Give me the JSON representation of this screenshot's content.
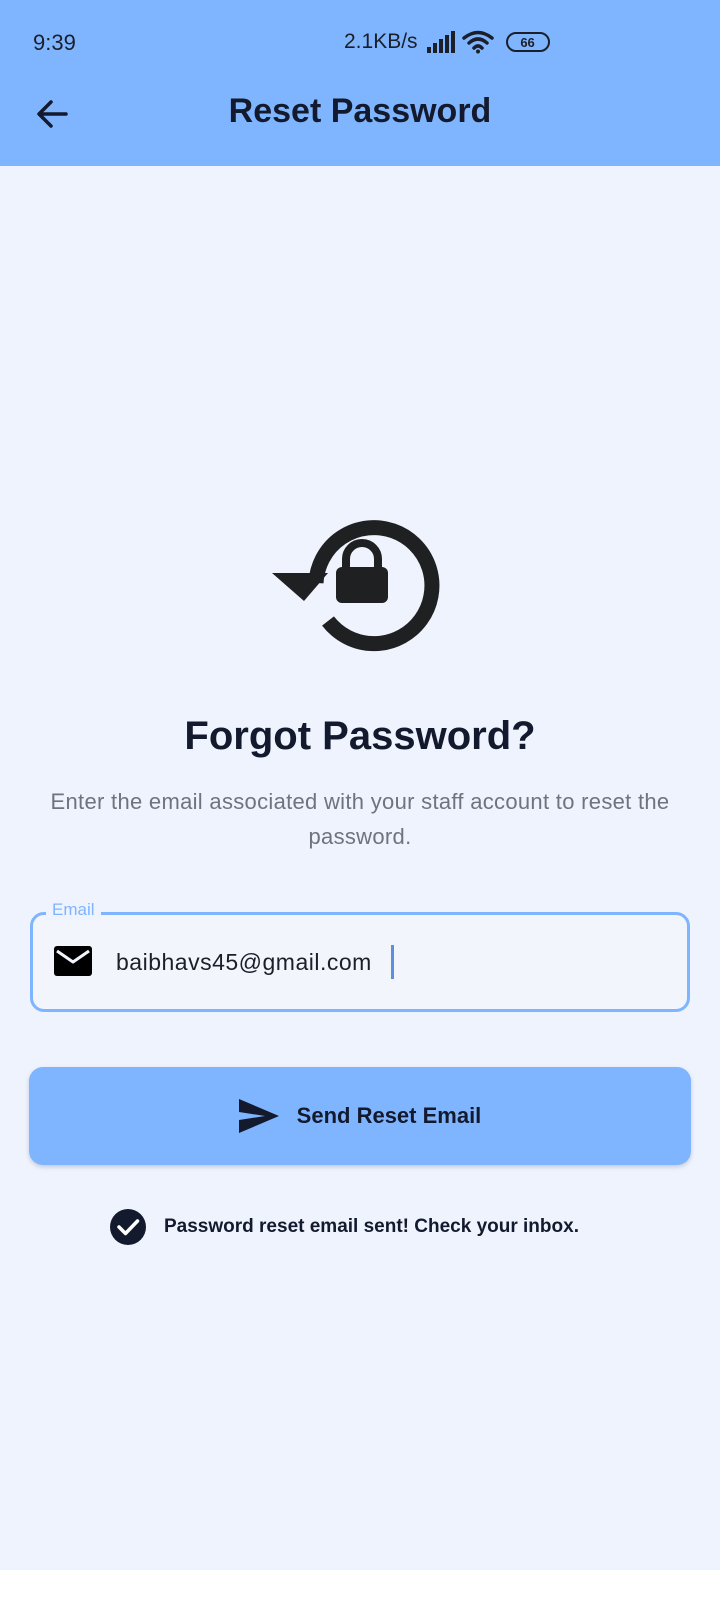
{
  "status_bar": {
    "time": "9:39",
    "network_speed": "2.1KB/s",
    "battery_level": "66",
    "icons": [
      "signal-icon",
      "wifi-icon",
      "battery-icon"
    ]
  },
  "app_bar": {
    "title": "Reset Password",
    "back_icon": "arrow-left-icon"
  },
  "hero": {
    "icon": "lock-reset-icon",
    "heading": "Forgot Password?",
    "subtitle": "Enter the email associated with your staff account to reset the password."
  },
  "email_field": {
    "label": "Email",
    "value": "baibhavs45@gmail.com",
    "icon": "mail-icon"
  },
  "send_button": {
    "label": "Send Reset Email",
    "icon": "send-icon"
  },
  "status_message": {
    "text": "Password reset email sent! Check your inbox.",
    "icon": "check-circle-icon"
  },
  "colors": {
    "primary": "#7fb5ff",
    "background": "#eff3fd",
    "text_dark": "#141a2e",
    "text_muted": "#6f7380"
  }
}
